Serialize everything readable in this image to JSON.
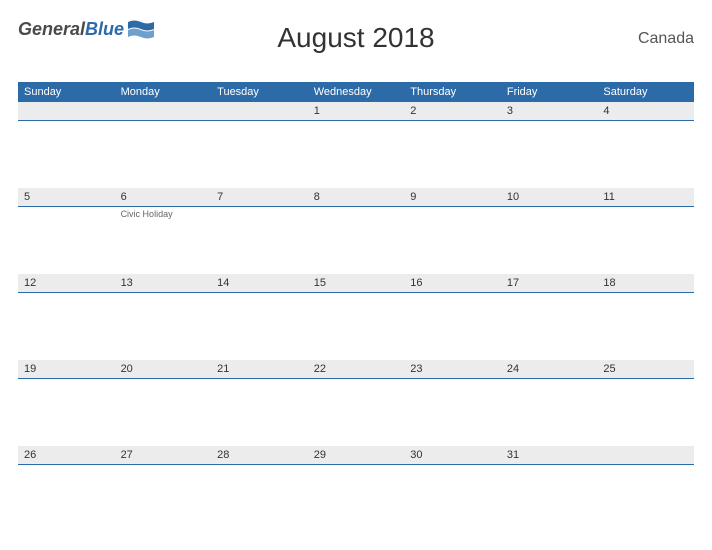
{
  "logo": {
    "text1": "General",
    "text2": "Blue"
  },
  "title": "August 2018",
  "region": "Canada",
  "day_headers": [
    "Sunday",
    "Monday",
    "Tuesday",
    "Wednesday",
    "Thursday",
    "Friday",
    "Saturday"
  ],
  "weeks": [
    {
      "dates": [
        "",
        "",
        "",
        "1",
        "2",
        "3",
        "4"
      ],
      "events": [
        "",
        "",
        "",
        "",
        "",
        "",
        ""
      ]
    },
    {
      "dates": [
        "5",
        "6",
        "7",
        "8",
        "9",
        "10",
        "11"
      ],
      "events": [
        "",
        "Civic Holiday",
        "",
        "",
        "",
        "",
        ""
      ]
    },
    {
      "dates": [
        "12",
        "13",
        "14",
        "15",
        "16",
        "17",
        "18"
      ],
      "events": [
        "",
        "",
        "",
        "",
        "",
        "",
        ""
      ]
    },
    {
      "dates": [
        "19",
        "20",
        "21",
        "22",
        "23",
        "24",
        "25"
      ],
      "events": [
        "",
        "",
        "",
        "",
        "",
        "",
        ""
      ]
    },
    {
      "dates": [
        "26",
        "27",
        "28",
        "29",
        "30",
        "31",
        ""
      ],
      "events": [
        "",
        "",
        "",
        "",
        "",
        "",
        ""
      ]
    }
  ]
}
